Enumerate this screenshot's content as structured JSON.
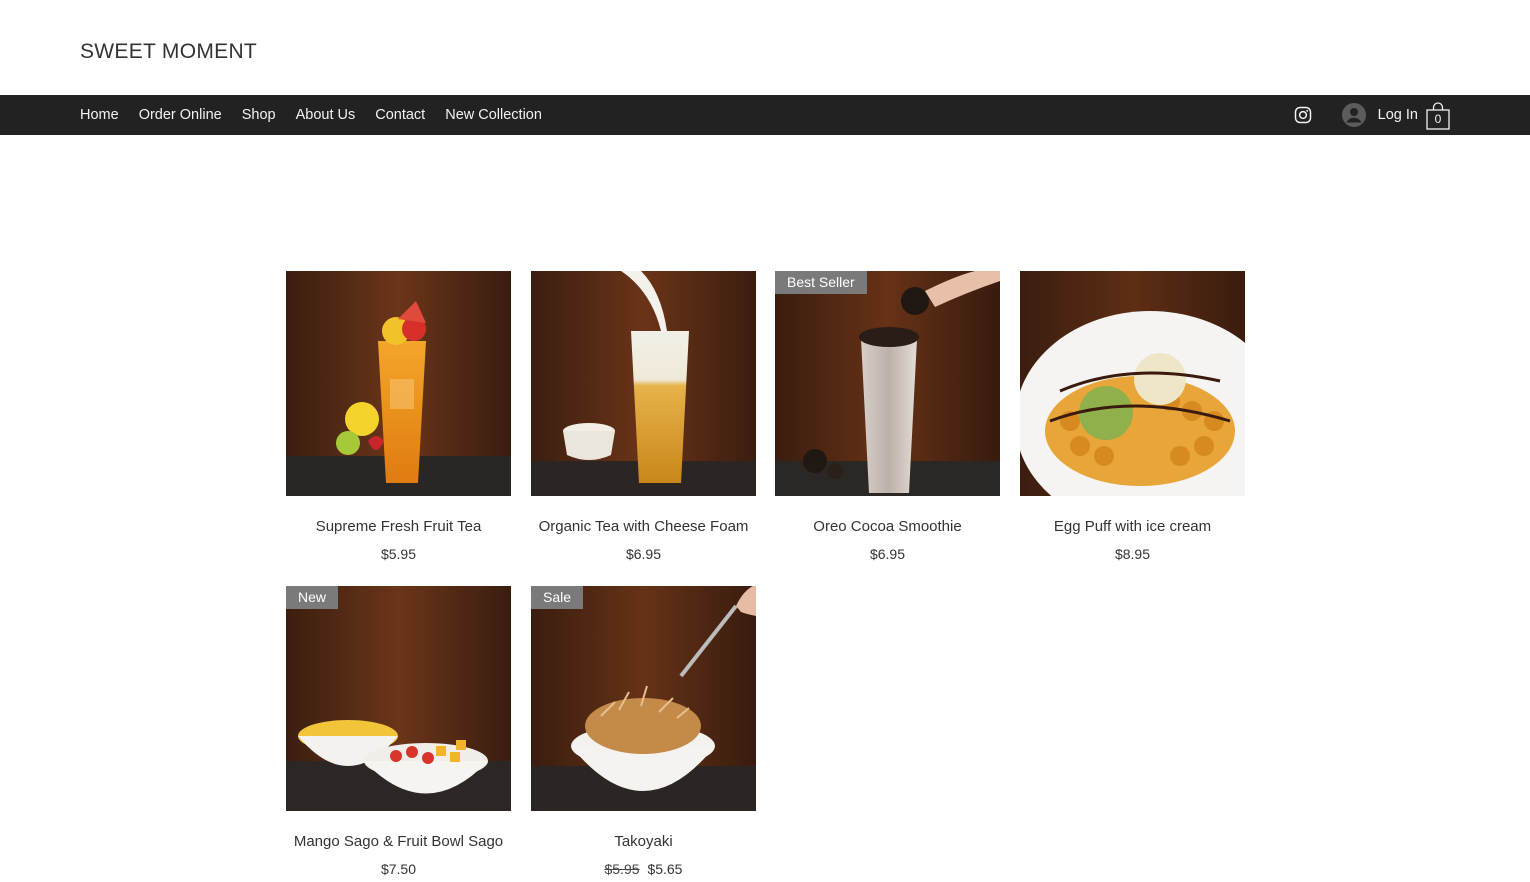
{
  "brand": {
    "name": "SWEET MOMENT"
  },
  "nav": {
    "items": [
      "Home",
      "Order Online",
      "Shop",
      "About Us",
      "Contact",
      "New Collection"
    ],
    "login_label": "Log In",
    "cart_count": "0"
  },
  "icons": {
    "social": "instagram-icon",
    "account": "user-avatar-icon",
    "cart": "shopping-bag-icon"
  },
  "colors": {
    "nav_background": "#222222",
    "ribbon": "#7a7a7a",
    "text": "#333333"
  },
  "products": [
    {
      "name": "Supreme Fresh Fruit Tea",
      "price": "$5.95",
      "ribbon": "",
      "old_price": ""
    },
    {
      "name": "Organic Tea with Cheese Foam",
      "price": "$6.95",
      "ribbon": "",
      "old_price": ""
    },
    {
      "name": "Oreo Cocoa Smoothie",
      "price": "$6.95",
      "ribbon": "Best Seller",
      "old_price": ""
    },
    {
      "name": "Egg Puff with ice cream",
      "price": "$8.95",
      "ribbon": "",
      "old_price": ""
    },
    {
      "name": "Mango Sago & Fruit Bowl Sago",
      "price": "$7.50",
      "ribbon": "New",
      "old_price": ""
    },
    {
      "name": "Takoyaki",
      "price": "$5.65",
      "ribbon": "Sale",
      "old_price": "$5.95"
    }
  ]
}
